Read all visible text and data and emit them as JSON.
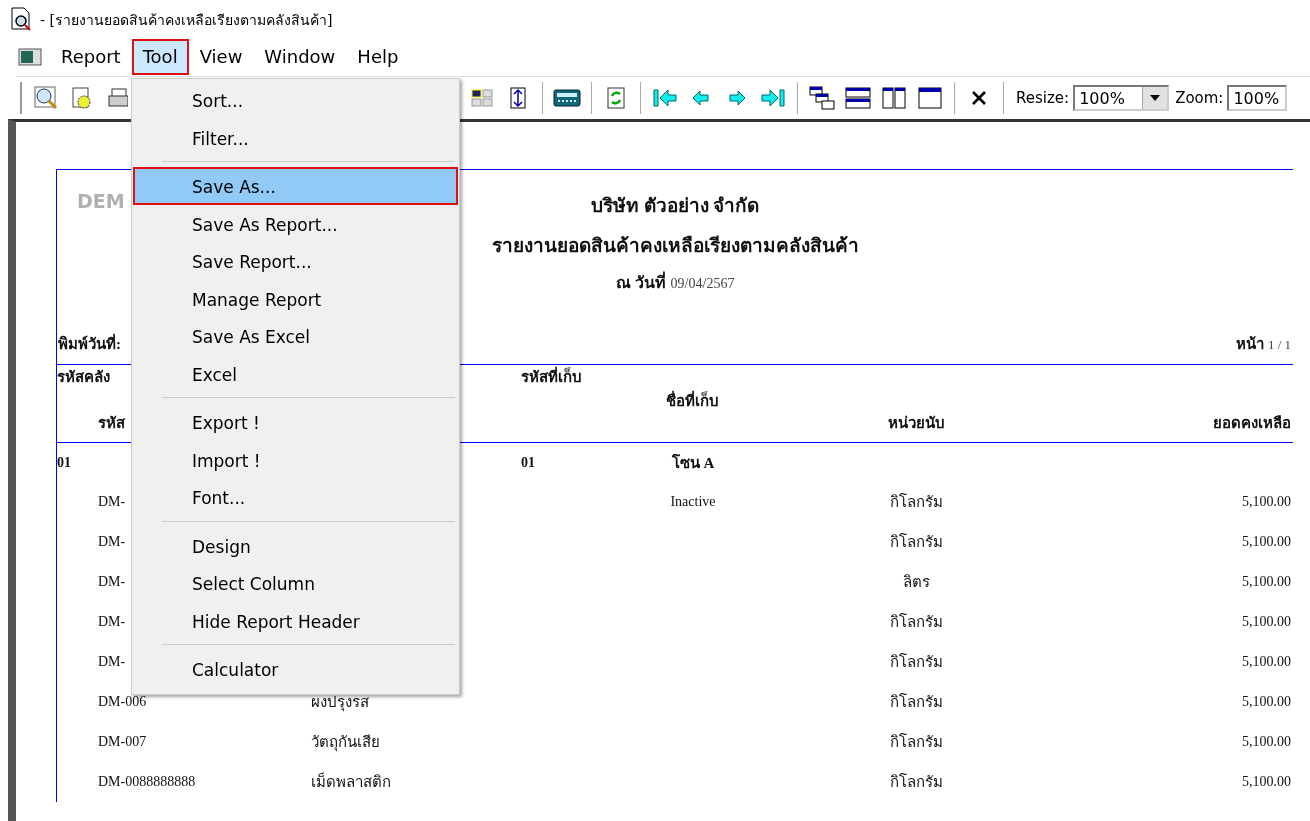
{
  "window": {
    "title": "- [รายงานยอดสินค้าคงเหลือเรียงตามคลังสินค้า]"
  },
  "menubar": [
    {
      "label": "Report",
      "selected": false
    },
    {
      "label": "Tool",
      "selected": true
    },
    {
      "label": "View",
      "selected": false
    },
    {
      "label": "Window",
      "selected": false
    },
    {
      "label": "Help",
      "selected": false
    }
  ],
  "toolbar": {
    "resize_label": "Resize:",
    "resize_value": "100%",
    "zoom_label": "Zoom:",
    "zoom_value": "100%"
  },
  "report": {
    "watermark": "DEM",
    "company": "บริษัท ตัวอย่าง จำกัด",
    "title": "รายงานยอดสินค้าคงเหลือเรียงตามคลังสินค้า",
    "date_label": "ณ วันที่",
    "date": "09/04/2567",
    "print_date_label": "พิมพ์วันที่:",
    "page_label": "หน้า",
    "page": "1 / 1",
    "columns": {
      "warehouse_code": "รหัสคลัง",
      "location_code": "รหัสที่เก็บ",
      "location_name": "ชื่อที่เก็บ",
      "product_code": "รหัส",
      "unit": "หน่วยนับ",
      "balance": "ยอดคงเหลือ"
    },
    "group": {
      "warehouse": "01",
      "location_code": "01",
      "location_name": "โซน A"
    },
    "rows": [
      {
        "code": "DM-",
        "status": "Inactive",
        "unit": "กิโลกรัม",
        "balance": "5,100.00"
      },
      {
        "code": "DM-",
        "unit": "กิโลกรัม",
        "balance": "5,100.00"
      },
      {
        "code": "DM-",
        "unit": "ลิตร",
        "balance": "5,100.00"
      },
      {
        "code": "DM-",
        "unit": "กิโลกรัม",
        "balance": "5,100.00"
      },
      {
        "code": "DM-",
        "unit": "กิโลกรัม",
        "balance": "5,100.00"
      },
      {
        "code": "DM-006",
        "name": "ผงปรุงรส",
        "unit": "กิโลกรัม",
        "balance": "5,100.00"
      },
      {
        "code": "DM-007",
        "name": "วัตถุกันเสีย",
        "unit": "กิโลกรัม",
        "balance": "5,100.00"
      },
      {
        "code": "DM-0088888888",
        "name": "เม็ดพลาสติก",
        "unit": "กิโลกรัม",
        "balance": "5,100.00"
      }
    ]
  },
  "menu": {
    "items": [
      {
        "kind": "item",
        "label": "Sort...",
        "selected": false
      },
      {
        "kind": "item",
        "label": "Filter...",
        "selected": false
      },
      {
        "kind": "separator"
      },
      {
        "kind": "item",
        "label": "Save As...",
        "selected": true
      },
      {
        "kind": "item",
        "label": "Save As Report...",
        "selected": false
      },
      {
        "kind": "item",
        "label": "Save Report...",
        "selected": false
      },
      {
        "kind": "item",
        "label": "Manage Report",
        "selected": false
      },
      {
        "kind": "item",
        "label": "Save As Excel",
        "selected": false
      },
      {
        "kind": "item",
        "label": "Excel",
        "selected": false
      },
      {
        "kind": "separator"
      },
      {
        "kind": "item",
        "label": "Export !",
        "selected": false
      },
      {
        "kind": "item",
        "label": "Import !",
        "selected": false
      },
      {
        "kind": "item",
        "label": "Font...",
        "selected": false
      },
      {
        "kind": "separator"
      },
      {
        "kind": "item",
        "label": "Design",
        "selected": false
      },
      {
        "kind": "item",
        "label": "Select Column",
        "selected": false
      },
      {
        "kind": "item",
        "label": "Hide Report Header",
        "selected": false
      },
      {
        "kind": "separator"
      },
      {
        "kind": "item",
        "label": "Calculator",
        "selected": false
      }
    ]
  }
}
